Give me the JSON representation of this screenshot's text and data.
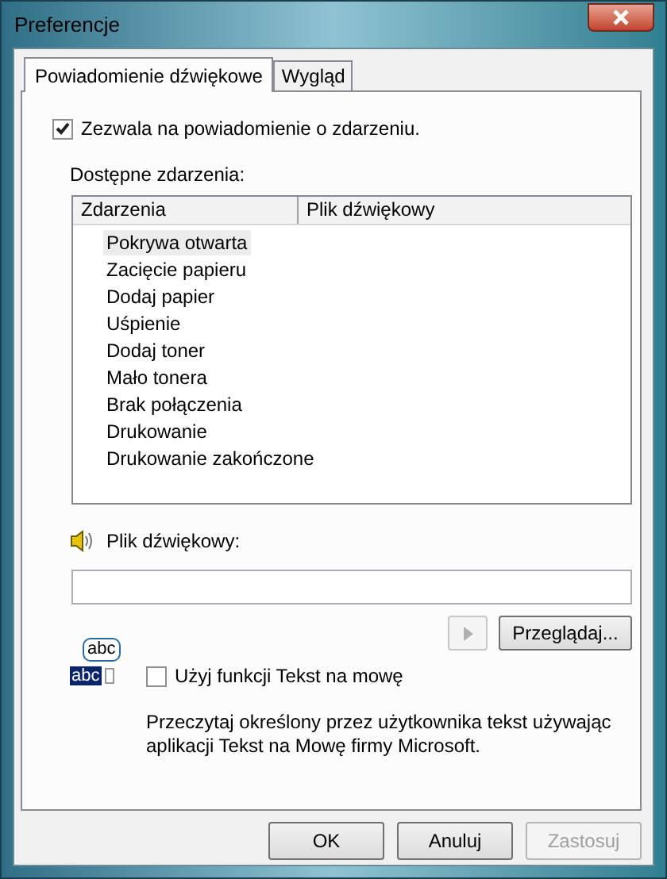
{
  "window": {
    "title": "Preferencje"
  },
  "tabs": [
    {
      "label": "Powiadomienie dźwiękowe",
      "selected": true
    },
    {
      "label": "Wygląd",
      "selected": false
    }
  ],
  "enable_checkbox": {
    "label": "Zezwala na powiadomienie o zdarzeniu.",
    "checked": true
  },
  "events_label": "Dostępne zdarzenia:",
  "events_table": {
    "columns": [
      "Zdarzenia",
      "Plik dźwiękowy"
    ],
    "rows": [
      {
        "name": "Pokrywa otwarta",
        "selected": true
      },
      {
        "name": "Zacięcie papieru",
        "selected": false
      },
      {
        "name": "Dodaj papier",
        "selected": false
      },
      {
        "name": "Uśpienie",
        "selected": false
      },
      {
        "name": "Dodaj toner",
        "selected": false
      },
      {
        "name": "Mało tonera",
        "selected": false
      },
      {
        "name": "Brak połączenia",
        "selected": false
      },
      {
        "name": "Drukowanie",
        "selected": false
      },
      {
        "name": "Drukowanie zakończone",
        "selected": false
      }
    ]
  },
  "sound_file": {
    "label": "Plik dźwiękowy:"
  },
  "play_button": {
    "disabled": true
  },
  "browse_button": {
    "label": "Przeglądaj...",
    "disabled": false
  },
  "tts_icon": {
    "bubble_text": "abc",
    "highlight_text": "abc"
  },
  "tts_checkbox": {
    "label": "Użyj funkcji Tekst na mowę",
    "checked": false
  },
  "tts_description": "Przeczytaj określony przez użytkownika tekst używając aplikacji Tekst na Mowę firmy Microsoft.",
  "buttons": [
    {
      "label": "OK",
      "disabled": false
    },
    {
      "label": "Anuluj",
      "disabled": false
    },
    {
      "label": "Zastosuj",
      "disabled": true
    }
  ]
}
